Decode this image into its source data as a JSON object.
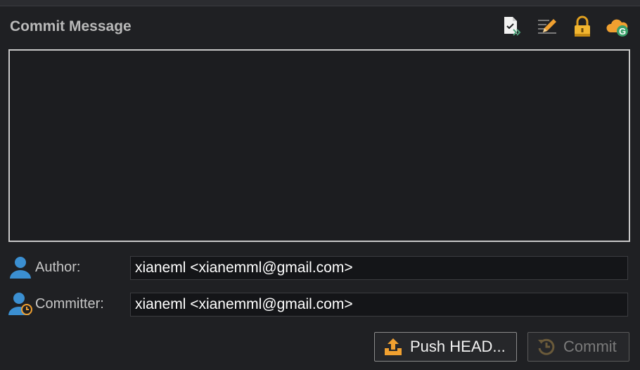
{
  "panel": {
    "title": "Commit Message"
  },
  "toolbar": {
    "icons": [
      "add-signed-off-by-icon",
      "amend-edit-icon",
      "sign-commit-lock-icon",
      "gerrit-change-id-icon"
    ]
  },
  "message": {
    "value": ""
  },
  "author": {
    "label": "Author:",
    "value": "xianeml <xianemml@gmail.com>"
  },
  "committer": {
    "label": "Committer:",
    "value": "xianeml <xianemml@gmail.com>"
  },
  "buttons": {
    "push_label": "Push HEAD...",
    "commit_label": "Commit"
  },
  "colors": {
    "accent_orange": "#f0a030",
    "person_blue": "#3b8fd1",
    "background": "#1f2023"
  }
}
